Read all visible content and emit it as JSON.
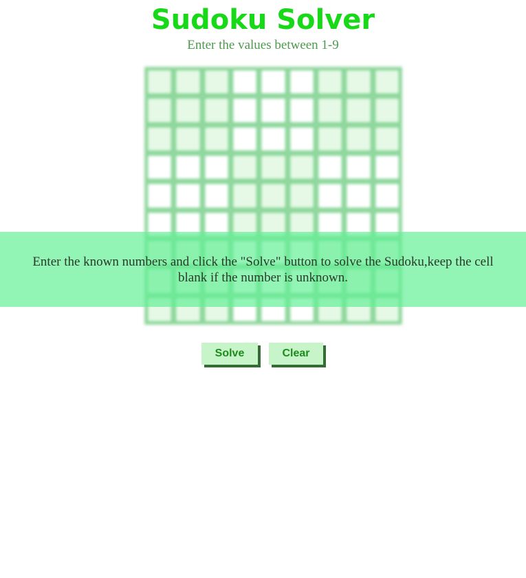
{
  "header": {
    "title": "Sudoku Solver",
    "subtitle": "Enter the values between 1-9"
  },
  "grid": {
    "size": 9,
    "values": [
      [
        "",
        "",
        "",
        "",
        "",
        "",
        "",
        "",
        ""
      ],
      [
        "",
        "",
        "",
        "",
        "",
        "",
        "",
        "",
        ""
      ],
      [
        "",
        "",
        "",
        "",
        "",
        "",
        "",
        "",
        ""
      ],
      [
        "",
        "",
        "",
        "",
        "",
        "",
        "",
        "",
        ""
      ],
      [
        "",
        "",
        "",
        "",
        "",
        "",
        "",
        "",
        ""
      ],
      [
        "",
        "",
        "",
        "",
        "",
        "",
        "",
        "",
        ""
      ],
      [
        "",
        "",
        "",
        "",
        "",
        "",
        "",
        "",
        ""
      ],
      [
        "",
        "",
        "",
        "",
        "",
        "",
        "",
        "",
        ""
      ],
      [
        "",
        "",
        "",
        "",
        "",
        "",
        "",
        "",
        ""
      ]
    ]
  },
  "overlay": {
    "message": "Enter the known numbers and click the \"Solve\" button to solve the Sudoku,keep the cell blank if the number is unknown."
  },
  "buttons": {
    "solve_label": "Solve",
    "clear_label": "Clear"
  },
  "colors": {
    "title": "#17d917",
    "subtitle": "#4c9a4c",
    "cell_shaded": "#e6f9e6",
    "cell_plain": "#ffffff",
    "overlay": "#64f096",
    "button_bg": "#c7f5c9",
    "button_text": "#1c8c1c",
    "button_shadow": "#356b35"
  }
}
